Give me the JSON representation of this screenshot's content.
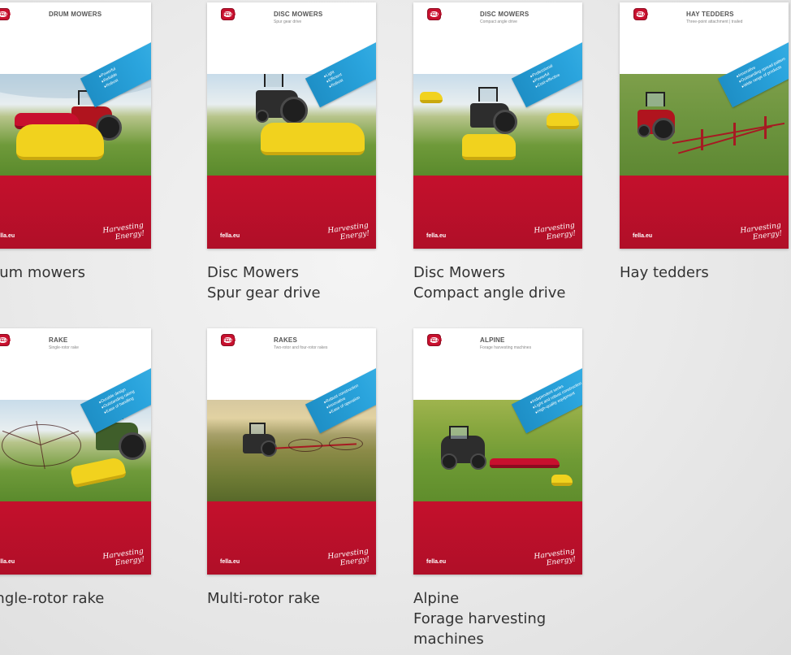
{
  "brand": {
    "logo_text": "FELLA",
    "domain": "fella.eu",
    "slogan_line1": "Harvesting",
    "slogan_line2": "Energy!",
    "red": "#c8102e",
    "ribbon_blue": "#2aa4dd"
  },
  "brochures": [
    {
      "cover_title": "DRUM MOWERS",
      "cover_subtitle": "",
      "features": [
        "Powerful",
        "Reliable",
        "Robust"
      ],
      "caption": "Drum mowers"
    },
    {
      "cover_title": "DISC MOWERS",
      "cover_subtitle": "Spur gear drive",
      "features": [
        "Light",
        "Efficient",
        "Robust"
      ],
      "caption": "Disc Mowers\nSpur gear drive"
    },
    {
      "cover_title": "DISC MOWERS",
      "cover_subtitle": "Compact angle drive",
      "features": [
        "Professional",
        "Powerful",
        "Cost-effective"
      ],
      "caption": "Disc Mowers\nCompact angle drive"
    },
    {
      "cover_title": "HAY TEDDERS",
      "cover_subtitle": "Three-point attachment | trailed",
      "features": [
        "Innovative",
        "Outstanding spread pattern",
        "Wide range of products"
      ],
      "caption": "Hay tedders"
    },
    {
      "cover_title": "RAKE",
      "cover_subtitle": "Single-rotor rake",
      "features": [
        "Durable design",
        "Outstanding raking",
        "Ease of handling"
      ],
      "caption": "Single-rotor rake"
    },
    {
      "cover_title": "RAKES",
      "cover_subtitle": "Two-rotor and four-rotor rakes",
      "features": [
        "Robust construction",
        "Innovative",
        "Ease of operation"
      ],
      "caption": "Multi-rotor rake"
    },
    {
      "cover_title": "ALPINE",
      "cover_subtitle": "Forage harvesting machines",
      "features": [
        "Independent series",
        "Light and robust construction",
        "High-quality equipment"
      ],
      "caption": "Alpine\nForage harvesting\nmachines"
    }
  ]
}
